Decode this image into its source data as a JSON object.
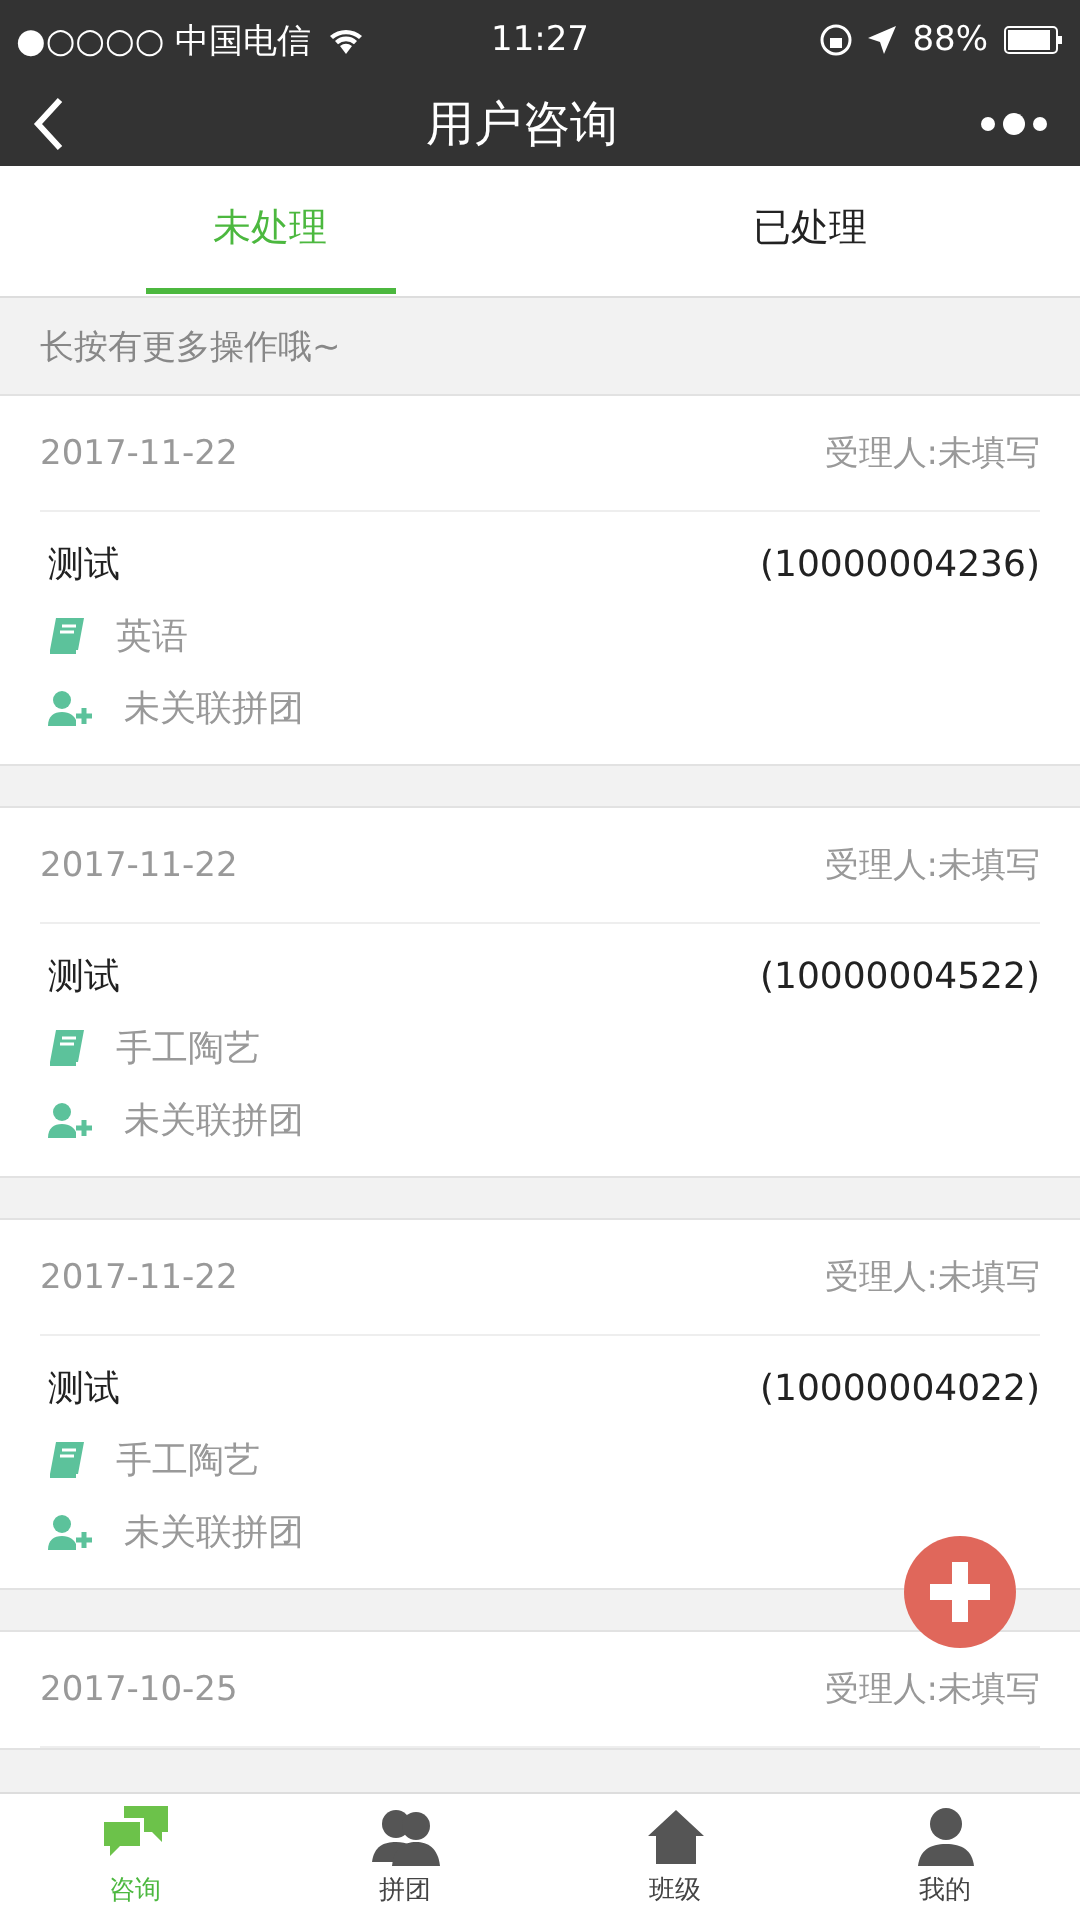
{
  "status_bar": {
    "carrier": "●○○○○ 中国电信",
    "time": "11:27",
    "battery": "88%"
  },
  "nav": {
    "title": "用户咨询"
  },
  "tabs": [
    {
      "label": "未处理",
      "selected": true
    },
    {
      "label": "已处理",
      "selected": false
    }
  ],
  "hint": "长按有更多操作哦~",
  "cards": [
    {
      "date": "2017-11-22",
      "handler": "受理人:未填写",
      "name": "测试",
      "number": "(10000004236)",
      "course": "英语",
      "group": "未关联拼团"
    },
    {
      "date": "2017-11-22",
      "handler": "受理人:未填写",
      "name": "测试",
      "number": "(10000004522)",
      "course": "手工陶艺",
      "group": "未关联拼团"
    },
    {
      "date": "2017-11-22",
      "handler": "受理人:未填写",
      "name": "测试",
      "number": "(10000004022)",
      "course": "手工陶艺",
      "group": "未关联拼团"
    },
    {
      "date": "2017-10-25",
      "handler": "受理人:未填写"
    }
  ],
  "bottom_nav": [
    {
      "label": "咨询",
      "kind": "chat",
      "selected": true
    },
    {
      "label": "拼团",
      "kind": "group",
      "selected": false
    },
    {
      "label": "班级",
      "kind": "home",
      "selected": false
    },
    {
      "label": "我的",
      "kind": "user",
      "selected": false
    }
  ]
}
